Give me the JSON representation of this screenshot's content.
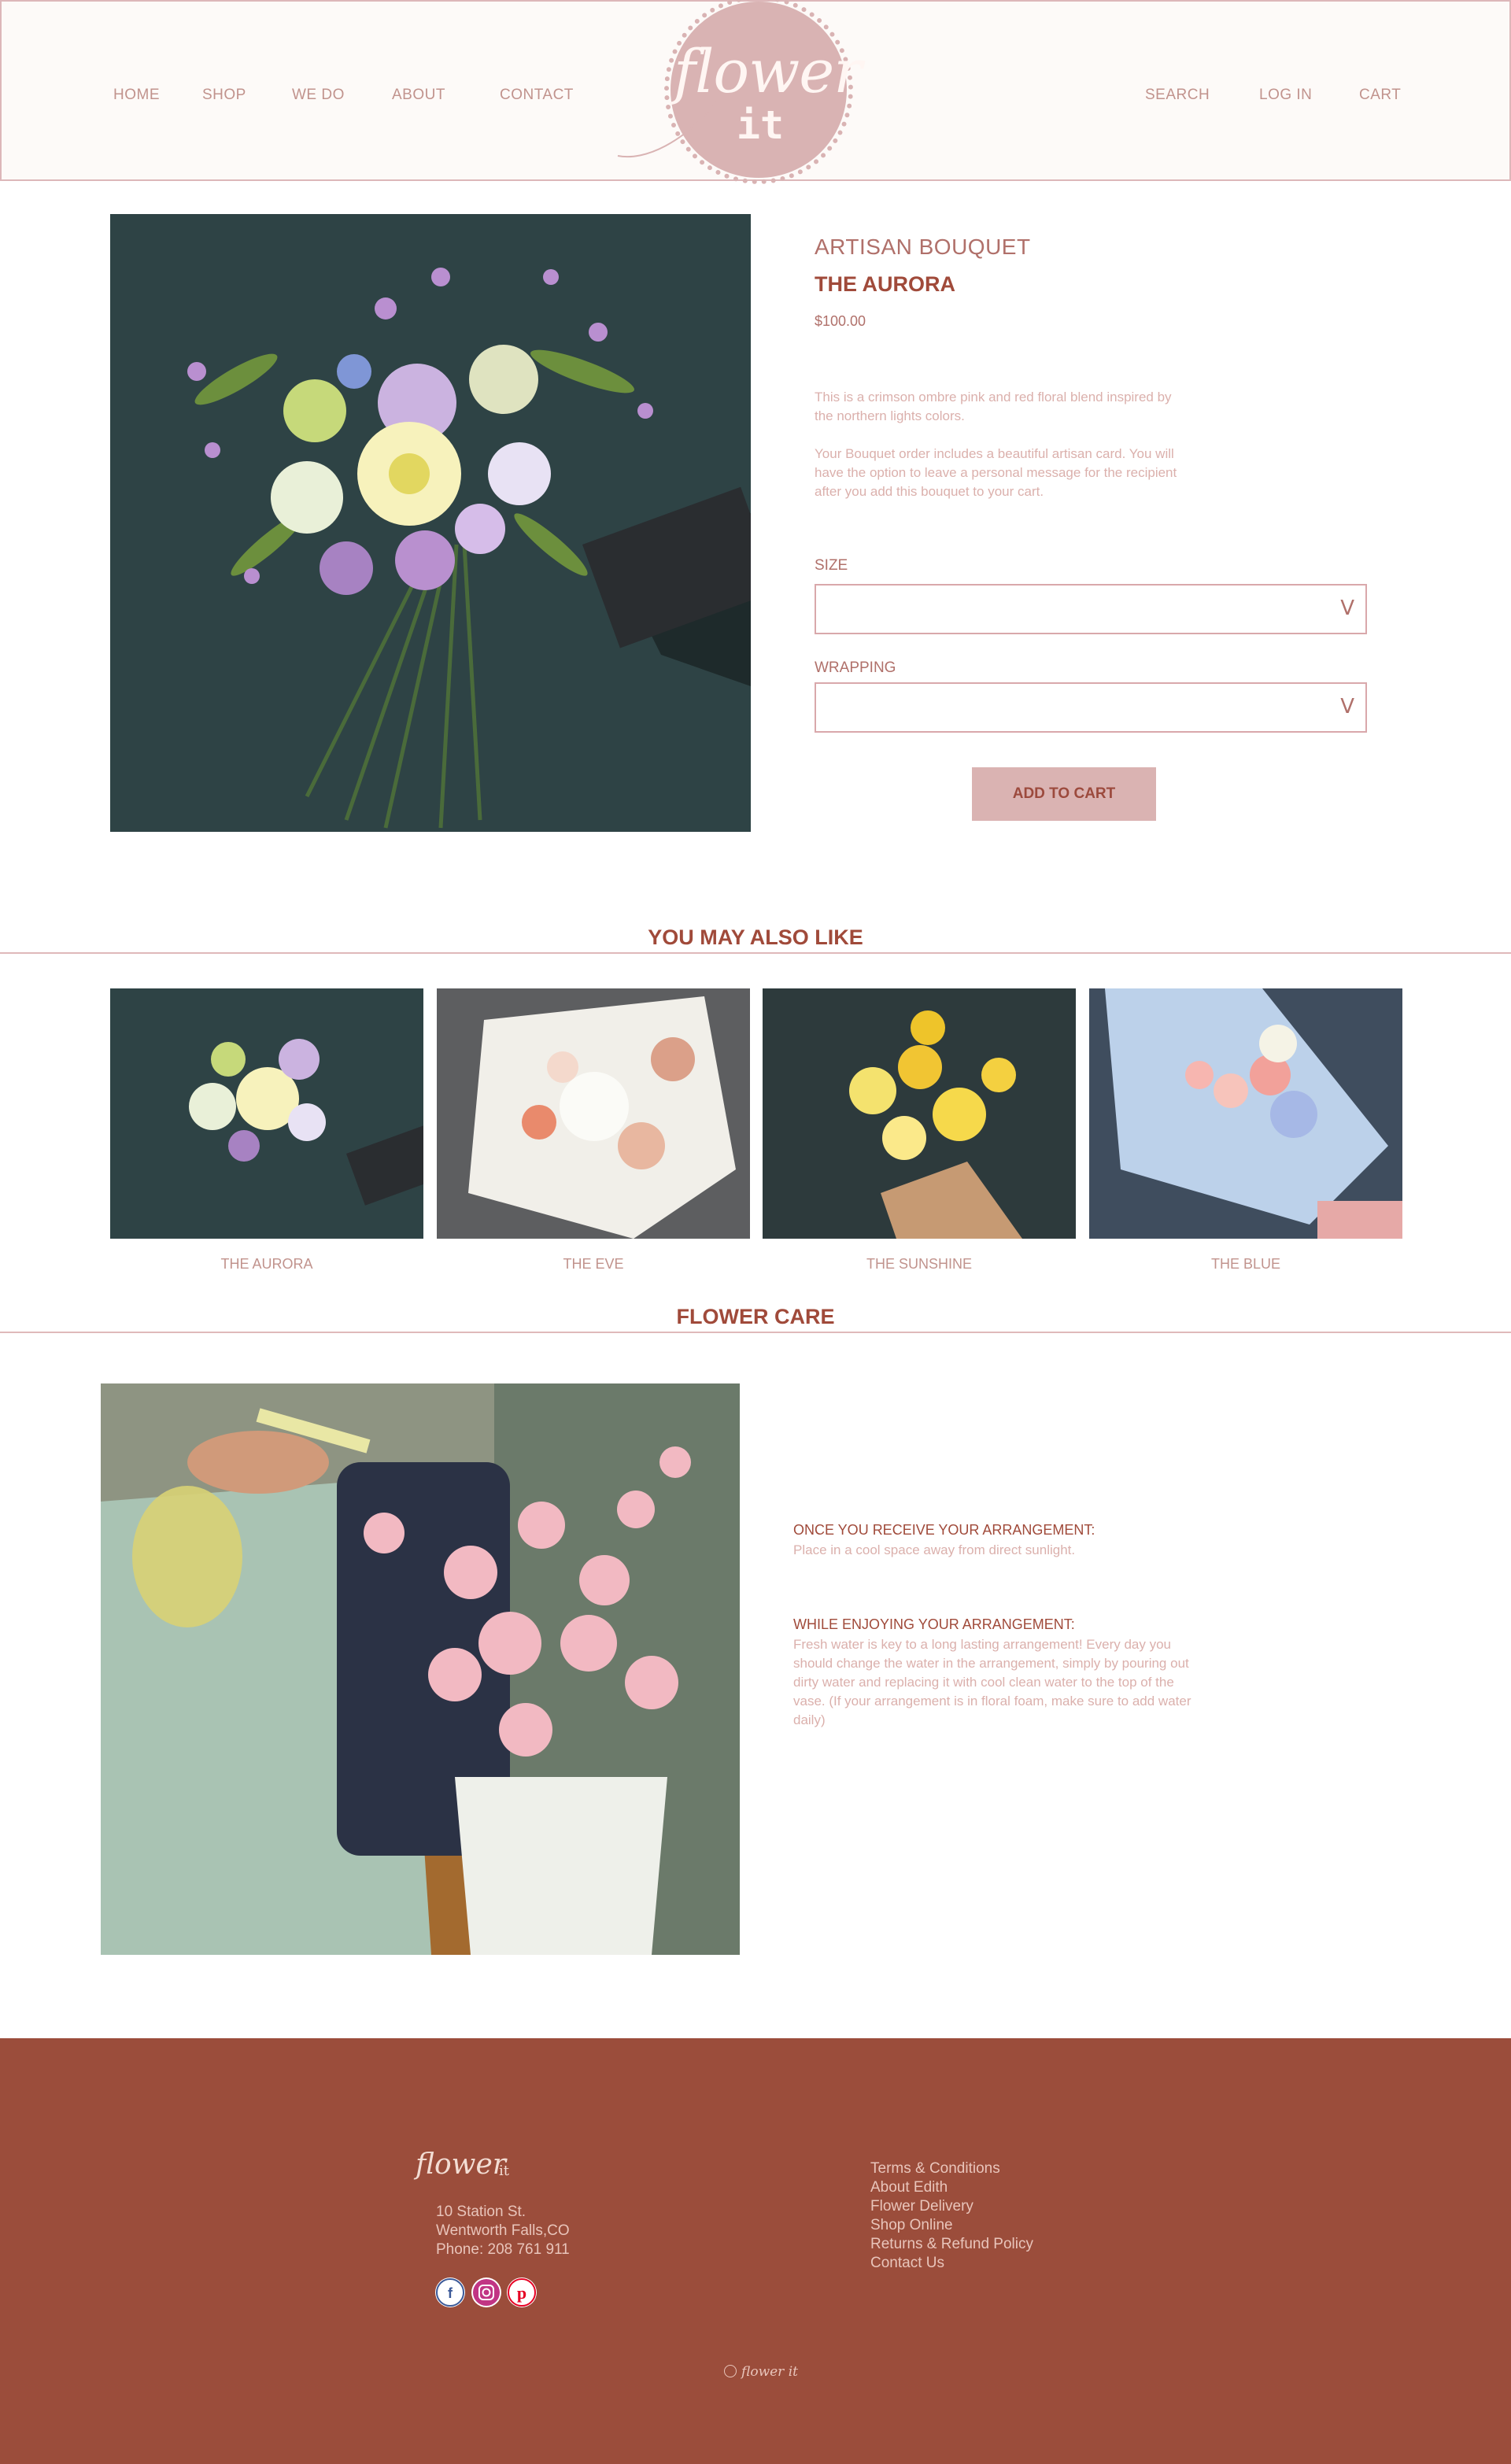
{
  "header": {
    "nav_left": [
      "HOME",
      "SHOP",
      "WE DO",
      "ABOUT",
      "CONTACT"
    ],
    "nav_right": [
      "SEARCH",
      "LOG IN",
      "CART"
    ],
    "logo": {
      "word1": "flower",
      "word2": "it"
    }
  },
  "product": {
    "category": "ARTISAN BOUQUET",
    "name": "THE AURORA",
    "price": "$100.00",
    "description_1": "This is a crimson ombre pink and red floral blend inspired by the northern lights colors.",
    "description_2": "Your Bouquet order includes a beautiful artisan card. You will have the option to leave a personal message for the recipient after you add this bouquet to your cart.",
    "size_label": "SIZE",
    "size_value": "",
    "wrapping_label": "WRAPPING",
    "wrapping_value": "",
    "chevron": "V",
    "add_to_cart": "ADD TO CART"
  },
  "recommendations": {
    "title": "YOU MAY ALSO LIKE",
    "items": [
      {
        "label": "THE AURORA"
      },
      {
        "label": "THE EVE"
      },
      {
        "label": "THE SUNSHINE"
      },
      {
        "label": "THE BLUE"
      }
    ]
  },
  "care": {
    "title": "FLOWER CARE",
    "sections": [
      {
        "heading": "ONCE YOU RECEIVE YOUR ARRANGEMENT:",
        "body": "Place in a cool space away from direct sunlight."
      },
      {
        "heading": "WHILE ENJOYING YOUR ARRANGEMENT:",
        "body": "Fresh water is key to a long lasting arrangement! Every day you should change the water in the arrangement, simply by pouring out dirty water and replacing it with cool clean water to the top of the vase. (If your arrangement is in floral foam, make sure to add water daily)"
      }
    ]
  },
  "footer": {
    "logo": {
      "word1": "flower",
      "word2": "it"
    },
    "address": [
      "10 Station St.",
      "Wentworth Falls,CO",
      "Phone: 208 761 911"
    ],
    "links": [
      "Terms & Conditions",
      "About Edith",
      "Flower Delivery",
      "Shop Online",
      "Returns & Refund Policy",
      "Contact Us"
    ],
    "social": [
      "facebook-icon",
      "instagram-icon",
      "pinterest-icon"
    ],
    "copyright_logo": "flower it"
  },
  "colors": {
    "header_bg": "#fdfaf8",
    "logo_pink": "#d9b3b3",
    "accent": "#a04a3a",
    "button": "#dab3b2",
    "footer_bg": "#9b4d3b"
  }
}
